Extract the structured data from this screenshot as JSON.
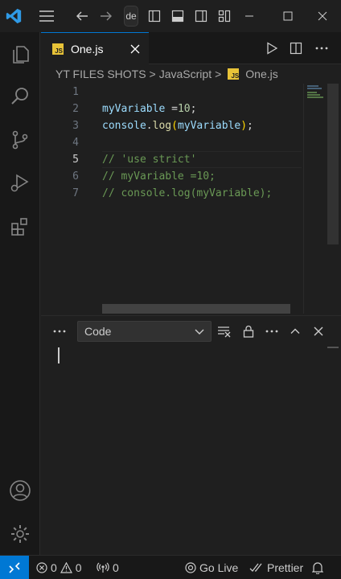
{
  "title_bar": {
    "search_text": "de",
    "icons": [
      "vscode-logo",
      "menu-icon",
      "arrow-left-icon",
      "arrow-right-icon",
      "toggle-primary-sidebar-icon",
      "toggle-panel-icon",
      "toggle-secondary-sidebar-icon",
      "customize-layout-icon",
      "minimize-icon",
      "maximize-icon",
      "close-icon"
    ]
  },
  "activity_bar": {
    "items": [
      "explorer-icon",
      "search-icon",
      "source-control-icon",
      "run-debug-icon",
      "extensions-icon",
      "accounts-icon",
      "manage-gear-icon"
    ]
  },
  "tab": {
    "badge": "JS",
    "label": "One.js"
  },
  "breadcrumbs": {
    "items": [
      "YT FILES SHOTS",
      "JavaScript",
      "One.js"
    ],
    "separator": ">"
  },
  "editor": {
    "line_numbers": [
      "1",
      "2",
      "3",
      "4",
      "5",
      "6",
      "7"
    ],
    "active_line": "5",
    "lines": {
      "l2_var": "myVariable",
      "l2_op": " =",
      "l2_num": "10",
      "l2_semi": ";",
      "l3_obj": "console",
      "l3_dot": ".",
      "l3_fn": "log",
      "l3_po": "(",
      "l3_arg": "myVariable",
      "l3_pc": ")",
      "l3_semi": ";",
      "l5": "// 'use strict'",
      "l6": "// myVariable =10;",
      "l7": "// console.log(myVariable);"
    }
  },
  "panel": {
    "select_value": "Code"
  },
  "status_bar": {
    "errors": "0",
    "warnings": "0",
    "ports": "0",
    "go_live": "Go Live",
    "prettier": "Prettier"
  },
  "colors": {
    "accent": "#0078d4",
    "js_badge": "#e8c338",
    "comment": "#6a9955",
    "variable": "#9cdcfe",
    "function": "#dcdcaa",
    "number": "#b5cea8"
  }
}
